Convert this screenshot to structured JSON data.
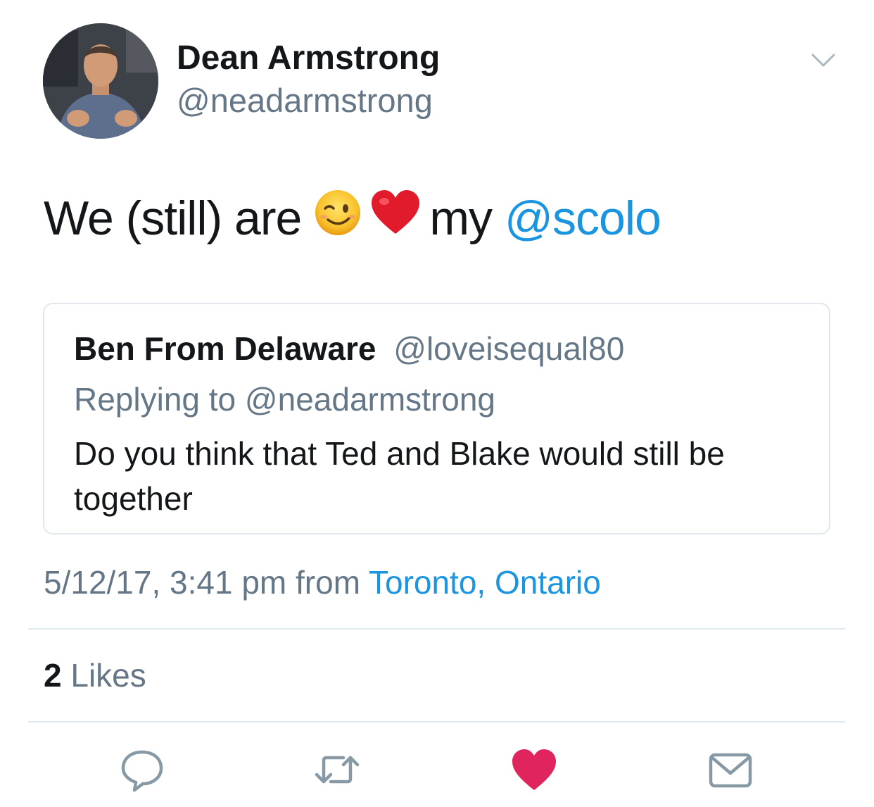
{
  "author": {
    "display_name": "Dean Armstrong",
    "handle": "@neadarmstrong"
  },
  "tweet": {
    "text_start": "We (still) are",
    "emojis": [
      "winking-face-emoji",
      "red-heart-emoji"
    ],
    "text_mid": "my",
    "mention": "@scolo"
  },
  "quoted_tweet": {
    "display_name": "Ben From Delaware",
    "handle": "@loveisequal80",
    "reply_prefix": "Replying to",
    "reply_handle": "@neadarmstrong",
    "body": "Do you think that Ted and Blake would still be together"
  },
  "meta": {
    "timestamp": "5/12/17, 3:41 pm",
    "from_word": "from",
    "location": "Toronto, Ontario"
  },
  "stats": {
    "likes_count": "2",
    "likes_label": "Likes"
  },
  "actions": [
    "reply-icon",
    "retweet-icon",
    "like-icon",
    "direct-message-icon"
  ],
  "colors": {
    "link": "#1b95e0",
    "secondary_text": "#657786",
    "like_active": "#e0245e",
    "divider": "#e1e8ed"
  }
}
